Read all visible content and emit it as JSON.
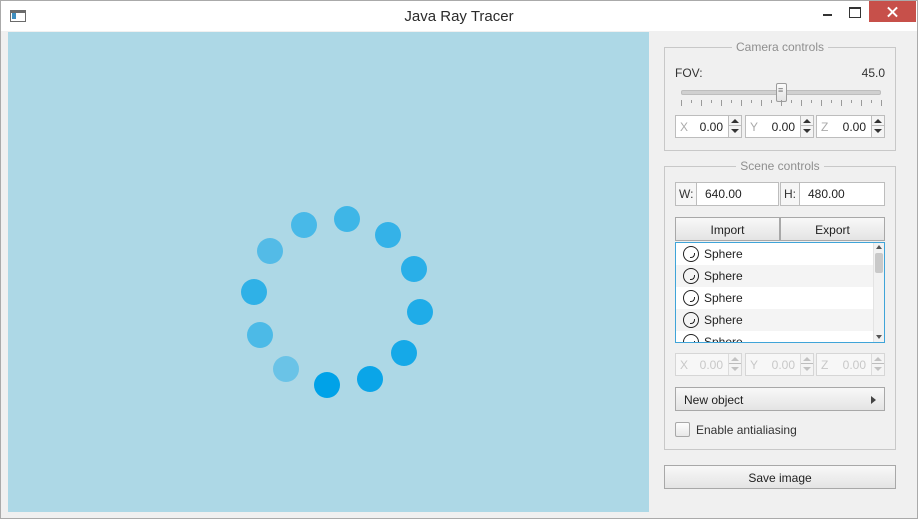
{
  "window": {
    "title": "Java Ray Tracer"
  },
  "render_area": {
    "background": "#add8e6",
    "loading_indicator": "busy-spinner",
    "spinner_color": "#00a2e8"
  },
  "camera_controls": {
    "legend": "Camera controls",
    "fov_label": "FOV:",
    "fov_value": "45.0",
    "fov_slider_fraction": 0.5,
    "position": [
      {
        "axis": "X",
        "value": "0.00"
      },
      {
        "axis": "Y",
        "value": "0.00"
      },
      {
        "axis": "Z",
        "value": "0.00"
      }
    ]
  },
  "scene_controls": {
    "legend": "Scene controls",
    "width_label": "W:",
    "width_value": "640.00",
    "height_label": "H:",
    "height_value": "480.00",
    "import_label": "Import",
    "export_label": "Export",
    "objects": [
      "Sphere",
      "Sphere",
      "Sphere",
      "Sphere",
      "Sphere"
    ],
    "object_position": [
      {
        "axis": "X",
        "value": "0.00"
      },
      {
        "axis": "Y",
        "value": "0.00"
      },
      {
        "axis": "Z",
        "value": "0.00"
      }
    ],
    "new_object_label": "New object",
    "antialiasing_label": "Enable antialiasing",
    "antialiasing_checked": false
  },
  "save_image_label": "Save image",
  "colors": {
    "accent": "#3fa4d8",
    "close_button": "#c7504a"
  }
}
